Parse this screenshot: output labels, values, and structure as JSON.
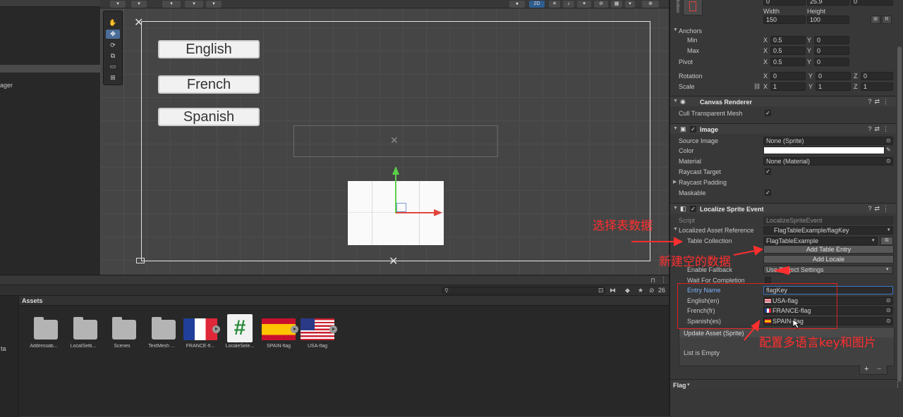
{
  "hierarchy": {
    "partial_item": "ager"
  },
  "scene": {
    "view_mode": "2D",
    "languages": [
      "English",
      "French",
      "Spanish"
    ]
  },
  "project": {
    "assets_title": "Assets",
    "layer_count": "26",
    "left_partial": "ta",
    "assets": [
      {
        "label": "Addressab...",
        "icon": "folder-icon"
      },
      {
        "label": "LocalSetti...",
        "icon": "folder-icon"
      },
      {
        "label": "Scenes",
        "icon": "folder-icon"
      },
      {
        "label": "TextMesh ...",
        "icon": "folder-icon"
      },
      {
        "label": "FRANCE-fl...",
        "icon": "france-flag-icon"
      },
      {
        "label": "LocaleSele...",
        "icon": "script-icon"
      },
      {
        "label": "SPAIN-flag",
        "icon": "spain-flag-icon"
      },
      {
        "label": "USA-flag",
        "icon": "usa-flag-icon"
      }
    ]
  },
  "inspector": {
    "rect": {
      "top_values": [
        "0",
        "25.9",
        "0"
      ],
      "anchor_preset_label": "bottom",
      "width_label": "Width",
      "height_label": "Height",
      "width": "150",
      "height": "100",
      "raw_button": "R",
      "anchors_label": "Anchors",
      "min_label": "Min",
      "max_label": "Max",
      "min_x": "0.5",
      "min_y": "0",
      "max_x": "0.5",
      "max_y": "0",
      "pivot_label": "Pivot",
      "pivot_x": "0.5",
      "pivot_y": "0",
      "rotation_label": "Rotation",
      "rotation": [
        "0",
        "0",
        "0"
      ],
      "scale_label": "Scale",
      "scale": [
        "1",
        "1",
        "1"
      ],
      "x": "X",
      "y": "Y",
      "z": "Z"
    },
    "canvas_renderer": {
      "title": "Canvas Renderer",
      "cull_label": "Cull Transparent Mesh"
    },
    "image": {
      "title": "Image",
      "source_label": "Source Image",
      "source_value": "None (Sprite)",
      "color_label": "Color",
      "material_label": "Material",
      "material_value": "None (Material)",
      "raycast_target_label": "Raycast Target",
      "raycast_padding_label": "Raycast Padding",
      "maskable_label": "Maskable"
    },
    "localize": {
      "title": "Localize Sprite Event",
      "script_label": "Script",
      "script_value": "LocalizeSpriteEvent",
      "asset_ref_label": "Localized Asset Reference",
      "asset_ref_value": "FlagTableExample/flagKey",
      "table_collection_label": "Table Collection",
      "table_collection_value": "FlagTableExample",
      "add_table_entry": "Add Table Entry",
      "add_locale": "Add Locale",
      "enable_fallback_label": "Enable Fallback",
      "enable_fallback_value": "Use Project Settings",
      "wait_label": "Wait For Completion",
      "entry_name_label": "Entry Name",
      "entry_name_value": "flagKey",
      "locales": [
        {
          "label": "English(en)",
          "value": "USA-flag"
        },
        {
          "label": "French(fr)",
          "value": "FRANCE-flag"
        },
        {
          "label": "Spanish(es)",
          "value": "SPAIN-flag"
        }
      ],
      "update_asset_label": "Update Asset (Sprite)",
      "list_empty": "List is Empty",
      "add_symbol": "+",
      "remove_symbol": "−"
    },
    "footer": "Flag"
  },
  "annotations": {
    "select_table": "选择表数据",
    "new_empty_data": "新建空的数据",
    "configure": "配置多语言key和图片"
  },
  "colors": {
    "annotation_red": "#ff2f2f",
    "highlight_box": "#e02020",
    "move_x": "#e0463c",
    "move_y": "#5bd04a",
    "selection_blue": "#4c6d99"
  }
}
